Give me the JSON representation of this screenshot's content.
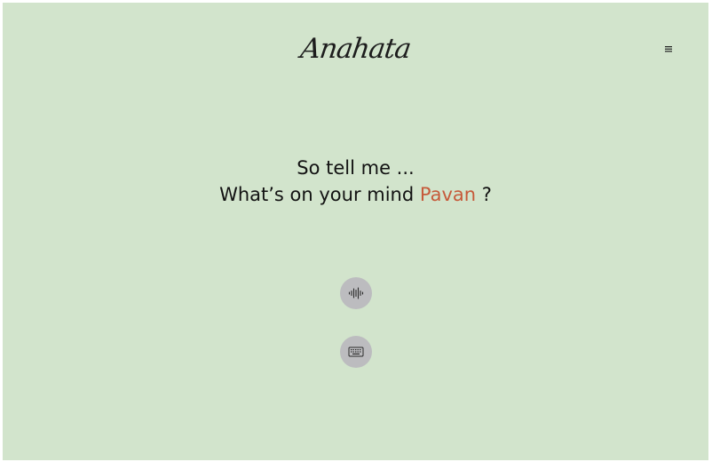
{
  "header": {
    "logo_text": "Anahata",
    "menu_icon": "hamburger-menu-icon"
  },
  "prompt": {
    "line1": "So tell me ...",
    "line2_prefix": "What’s on your mind",
    "user_name": "Pavan",
    "line2_suffix": "?"
  },
  "controls": {
    "voice_icon": "audio-waveform-icon",
    "keyboard_icon": "keyboard-icon"
  },
  "colors": {
    "background": "#d2e4cc",
    "accent_name": "#c65a3a",
    "button_bg": "#bcbcbf",
    "text": "#121212"
  }
}
